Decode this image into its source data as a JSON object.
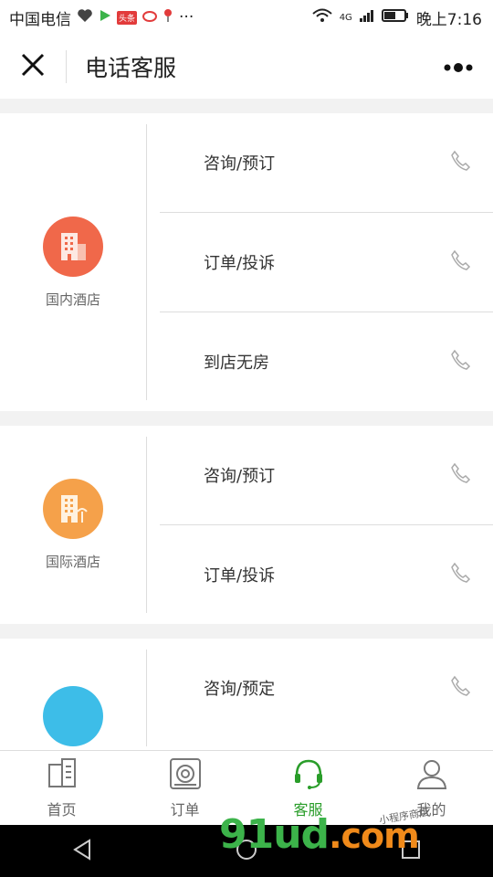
{
  "statusbar": {
    "carrier": "中国电信",
    "notif_badge": "头条",
    "more": "···",
    "network": "4G",
    "time": "晚上7:16"
  },
  "navbar": {
    "title": "电话客服"
  },
  "sections": [
    {
      "name": "国内酒店",
      "color": "#f0684a",
      "rows": [
        "咨询/预订",
        "订单/投诉",
        "到店无房"
      ]
    },
    {
      "name": "国际酒店",
      "color": "#f5a14a",
      "rows": [
        "咨询/预订",
        "订单/投诉"
      ]
    },
    {
      "name": "",
      "color": "#3dbde8",
      "rows": [
        "咨询/预定"
      ]
    }
  ],
  "tabs": [
    {
      "label": "首页",
      "icon": "home-icon"
    },
    {
      "label": "订单",
      "icon": "order-icon"
    },
    {
      "label": "客服",
      "icon": "headset-icon",
      "active": true
    },
    {
      "label": "我的",
      "icon": "user-icon"
    }
  ],
  "watermark": {
    "main": "91ud",
    "suffix": ".com",
    "small": "小程序商店"
  },
  "colors": {
    "active_tab": "#2a9d2a",
    "divider": "#dddddd"
  }
}
